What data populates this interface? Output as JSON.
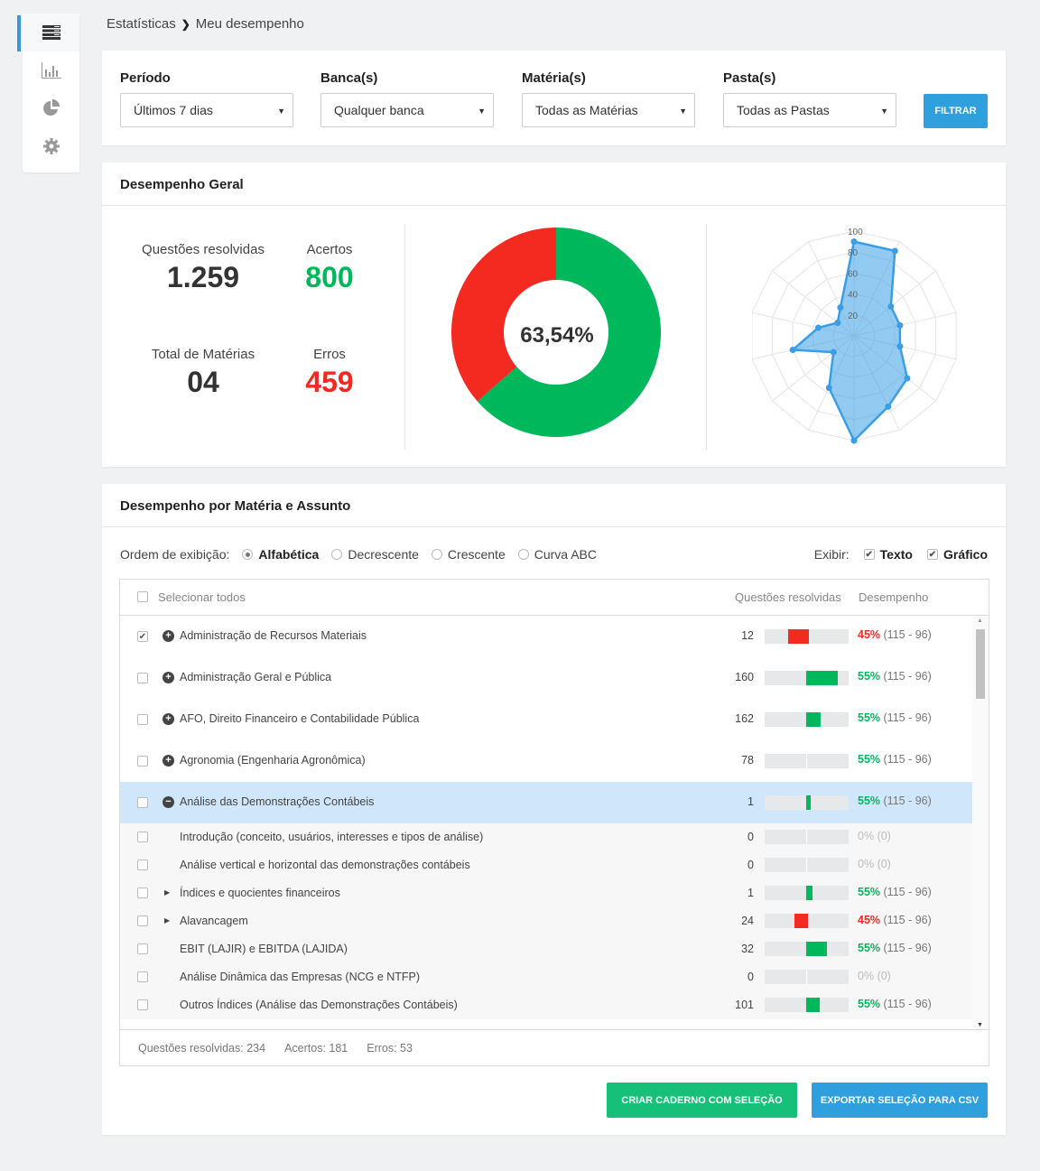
{
  "sidebar": {
    "items": [
      "list-icon",
      "bar-chart-icon",
      "pie-chart-icon",
      "gear-icon"
    ]
  },
  "breadcrumb": {
    "parent": "Estatísticas",
    "separator": "❯",
    "current": "Meu desempenho"
  },
  "filters": {
    "periodo": {
      "label": "Período",
      "value": "Últimos 7 dias"
    },
    "bancas": {
      "label": "Banca(s)",
      "value": "Qualquer banca"
    },
    "materias": {
      "label": "Matéria(s)",
      "value": "Todas as Matérias"
    },
    "pastas": {
      "label": "Pasta(s)",
      "value": "Todas as Pastas"
    },
    "button": "FILTRAR"
  },
  "geral": {
    "title": "Desempenho Geral",
    "questoes_label": "Questões resolvidas",
    "questoes_value": "1.259",
    "acertos_label": "Acertos",
    "acertos_value": "800",
    "materias_label": "Total de Matérias",
    "materias_value": "04",
    "erros_label": "Erros",
    "erros_value": "459",
    "percent": "63,54%",
    "colors": {
      "green": "#00b85c",
      "red": "#f4291f",
      "blue": "#3a9ee6"
    }
  },
  "chart_data": [
    {
      "type": "pie",
      "labels": [
        "Acertos",
        "Erros"
      ],
      "values": [
        800,
        459
      ],
      "colors": [
        "#00b85c",
        "#f4291f"
      ]
    },
    {
      "type": "radar",
      "scale_ticks": [
        "20",
        "40",
        "60",
        "80",
        "100"
      ],
      "values": [
        90,
        90,
        45,
        45,
        45,
        65,
        75,
        100,
        55,
        25,
        60,
        35,
        20,
        30
      ],
      "colors": [
        "#3a9ee6"
      ]
    }
  ],
  "materia": {
    "title": "Desempenho por Matéria e Assunto",
    "ordem_label": "Ordem de exibição:",
    "ordem_options": [
      "Alfabética",
      "Decrescente",
      "Crescente",
      "Curva ABC"
    ],
    "ordem_selected": "Alfabética",
    "exibir_label": "Exibir:",
    "exibir_texto": "Texto",
    "exibir_grafico": "Gráfico",
    "table": {
      "select_all": "Selecionar todos",
      "col_questoes": "Questões resolvidas",
      "col_desempenho": "Desempenho"
    },
    "rows": [
      {
        "kind": "main",
        "checked": true,
        "icon": "plus-circle-icon",
        "name": "Administração de Recursos Materiais",
        "qtd": "12",
        "pct": "45%",
        "range": "(115 - 96)",
        "fill": 0.25,
        "color": "red"
      },
      {
        "kind": "main",
        "checked": false,
        "icon": "plus-circle-icon",
        "name": "Administração Geral e Pública",
        "qtd": "160",
        "pct": "55%",
        "range": "(115 - 96)",
        "fill": 0.38,
        "color": "green"
      },
      {
        "kind": "main",
        "checked": false,
        "icon": "plus-circle-icon",
        "name": "AFO, Direito Financeiro e Contabilidade Pública",
        "qtd": "162",
        "pct": "55%",
        "range": "(115 - 96)",
        "fill": 0.17,
        "color": "green"
      },
      {
        "kind": "main",
        "checked": false,
        "icon": "plus-circle-icon",
        "name": "Agronomia (Engenharia Agronômica)",
        "qtd": "78",
        "pct": "55%",
        "range": "(115 - 96)",
        "fill": 0,
        "color": "green"
      },
      {
        "kind": "main",
        "checked": false,
        "icon": "minus-circle-icon",
        "selected": true,
        "name": "Análise das Demonstrações Contábeis",
        "qtd": "1",
        "pct": "55%",
        "range": "(115 - 96)",
        "fill": 0.05,
        "color": "green"
      },
      {
        "kind": "sub",
        "checked": false,
        "name": "Introdução (conceito, usuários, interesses e tipos de análise)",
        "qtd": "0",
        "pct": "0%",
        "range": "(0)",
        "fill": 0,
        "color": "gray"
      },
      {
        "kind": "sub",
        "checked": false,
        "name": "Análise vertical e horizontal das demonstrações contábeis",
        "qtd": "0",
        "pct": "0%",
        "range": "(0)",
        "fill": 0,
        "color": "gray"
      },
      {
        "kind": "sub",
        "checked": false,
        "arrow": true,
        "name": "Índices e quocientes financeiros",
        "qtd": "1",
        "pct": "55%",
        "range": "(115 - 96)",
        "fill": 0.08,
        "color": "green"
      },
      {
        "kind": "sub",
        "checked": false,
        "arrow": true,
        "name": "Alavancagem",
        "qtd": "24",
        "pct": "45%",
        "range": "(115 - 96)",
        "fill": 0.16,
        "color": "red"
      },
      {
        "kind": "sub",
        "checked": false,
        "name": "EBIT (LAJIR) e EBITDA (LAJIDA)",
        "qtd": "32",
        "pct": "55%",
        "range": "(115 - 96)",
        "fill": 0.25,
        "color": "green"
      },
      {
        "kind": "sub",
        "checked": false,
        "name": "Análise Dinâmica das Empresas (NCG e NTFP)",
        "qtd": "0",
        "pct": "0%",
        "range": "(0)",
        "fill": 0,
        "color": "gray"
      },
      {
        "kind": "sub",
        "checked": false,
        "name": "Outros Índices (Análise das Demonstrações Contábeis)",
        "qtd": "101",
        "pct": "55%",
        "range": "(115 - 96)",
        "fill": 0.16,
        "color": "green"
      }
    ],
    "footer": {
      "questoes": "Questões resolvidas: 234",
      "acertos": "Acertos: 181",
      "erros": "Erros: 53"
    },
    "btn_caderno": "CRIAR CADERNO COM SELEÇÃO",
    "btn_csv": "EXPORTAR SELEÇÃO PARA CSV"
  }
}
